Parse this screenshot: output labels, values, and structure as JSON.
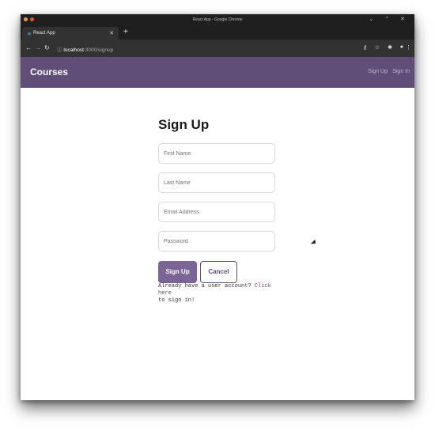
{
  "browser": {
    "window_title": "React App - Google Chrome",
    "tab_title": "React App",
    "url_host": "localhost",
    "url_path": ":3000/signup"
  },
  "app": {
    "brand": "Courses",
    "nav_links": [
      "Sign Up",
      "Sign In"
    ]
  },
  "form": {
    "title": "Sign Up",
    "fields": [
      {
        "placeholder": "First Name"
      },
      {
        "placeholder": "Last Name"
      },
      {
        "placeholder": "Email Address"
      },
      {
        "placeholder": "Password"
      }
    ],
    "submit_label": "Sign Up",
    "cancel_label": "Cancel",
    "footer_text": "Already have a user account?",
    "footer_link": "Click here",
    "footer_suffix": "to sign in!"
  },
  "colors": {
    "header_bg": "#604e79",
    "primary_button": "#7b6596"
  }
}
